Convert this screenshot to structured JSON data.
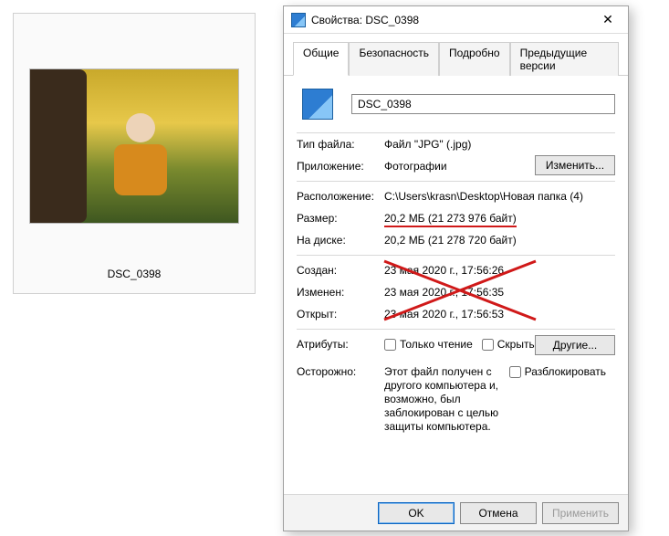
{
  "thumbnail": {
    "caption": "DSC_0398"
  },
  "dialog": {
    "title": "Свойства: DSC_0398",
    "tabs": {
      "general": "Общие",
      "security": "Безопасность",
      "details": "Подробно",
      "prev": "Предыдущие версии"
    },
    "filename": "DSC_0398",
    "labels": {
      "filetype": "Тип файла:",
      "app": "Приложение:",
      "location": "Расположение:",
      "size": "Размер:",
      "sizeondisk": "На диске:",
      "created": "Создан:",
      "modified": "Изменен:",
      "accessed": "Открыт:",
      "attributes": "Атрибуты:",
      "warning": "Осторожно:"
    },
    "values": {
      "filetype": "Файл \"JPG\" (.jpg)",
      "app": "Фотографии",
      "location": "C:\\Users\\krasn\\Desktop\\Новая папка (4)",
      "size": "20,2 МБ (21 273 976 байт)",
      "sizeondisk": "20,2 МБ (21 278 720 байт)",
      "created": "23 мая 2020 г., 17:56:26",
      "modified": "23 мая 2020 г., 17:56:35",
      "accessed": "23 мая 2020 г., 17:56:53",
      "warning": "Этот файл получен с другого компьютера и, возможно, был заблокирован с целью защиты компьютера."
    },
    "checkboxes": {
      "readonly": "Только чтение",
      "hidden": "Скрытый",
      "unblock": "Разблокировать"
    },
    "buttons": {
      "change": "Изменить...",
      "other": "Другие...",
      "ok": "OK",
      "cancel": "Отмена",
      "apply": "Применить"
    }
  }
}
